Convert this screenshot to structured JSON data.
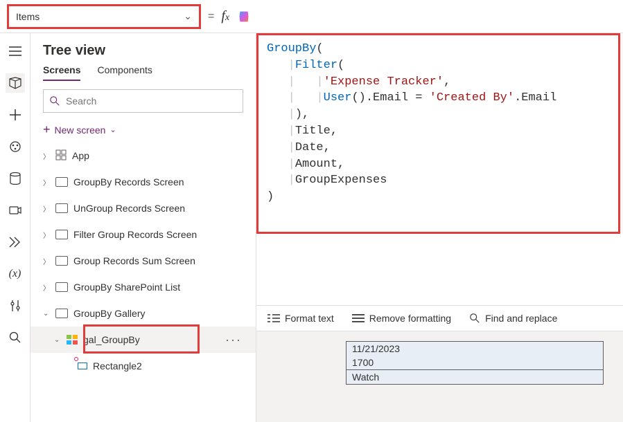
{
  "property": {
    "name": "Items"
  },
  "header": {
    "title": "Tree view",
    "tabs": {
      "screens": "Screens",
      "components": "Components"
    },
    "search_placeholder": "Search",
    "new_screen": "New screen"
  },
  "tree": {
    "app": "App",
    "items": [
      "GroupBy Records Screen",
      "UnGroup Records Screen",
      "Filter Group Records Screen",
      "Group Records Sum Screen",
      "GroupBy SharePoint List",
      "GroupBy Gallery"
    ],
    "selected": "gal_GroupBy",
    "child": "Rectangle2"
  },
  "chart_data": {
    "type": "code",
    "language": "PowerFx",
    "tokens": [
      {
        "t": "fn",
        "v": "GroupBy"
      },
      {
        "t": "p",
        "v": "("
      },
      {
        "t": "nl"
      },
      {
        "t": "pipe1"
      },
      {
        "t": "fn",
        "v": "Filter"
      },
      {
        "t": "p",
        "v": "("
      },
      {
        "t": "nl"
      },
      {
        "t": "pipe2"
      },
      {
        "t": "str",
        "v": "'Expense Tracker'"
      },
      {
        "t": "p",
        "v": ","
      },
      {
        "t": "nl"
      },
      {
        "t": "pipe2"
      },
      {
        "t": "fn",
        "v": "User"
      },
      {
        "t": "p",
        "v": "().Email = "
      },
      {
        "t": "str",
        "v": "'Created By'"
      },
      {
        "t": "p",
        "v": ".Email"
      },
      {
        "t": "nl"
      },
      {
        "t": "pipe1"
      },
      {
        "t": "p",
        "v": "),"
      },
      {
        "t": "nl"
      },
      {
        "t": "pipe1"
      },
      {
        "t": "p",
        "v": "Title,"
      },
      {
        "t": "nl"
      },
      {
        "t": "pipe1"
      },
      {
        "t": "p",
        "v": "Date,"
      },
      {
        "t": "nl"
      },
      {
        "t": "pipe1"
      },
      {
        "t": "p",
        "v": "Amount,"
      },
      {
        "t": "nl"
      },
      {
        "t": "pipe1"
      },
      {
        "t": "p",
        "v": "GroupExpenses"
      },
      {
        "t": "nl"
      },
      {
        "t": "p",
        "v": ")"
      }
    ]
  },
  "formula_toolbar": {
    "format": "Format text",
    "remove": "Remove formatting",
    "find": "Find and replace"
  },
  "canvas": {
    "row1": "11/21/2023",
    "row2": "1700",
    "row3": "Watch"
  }
}
